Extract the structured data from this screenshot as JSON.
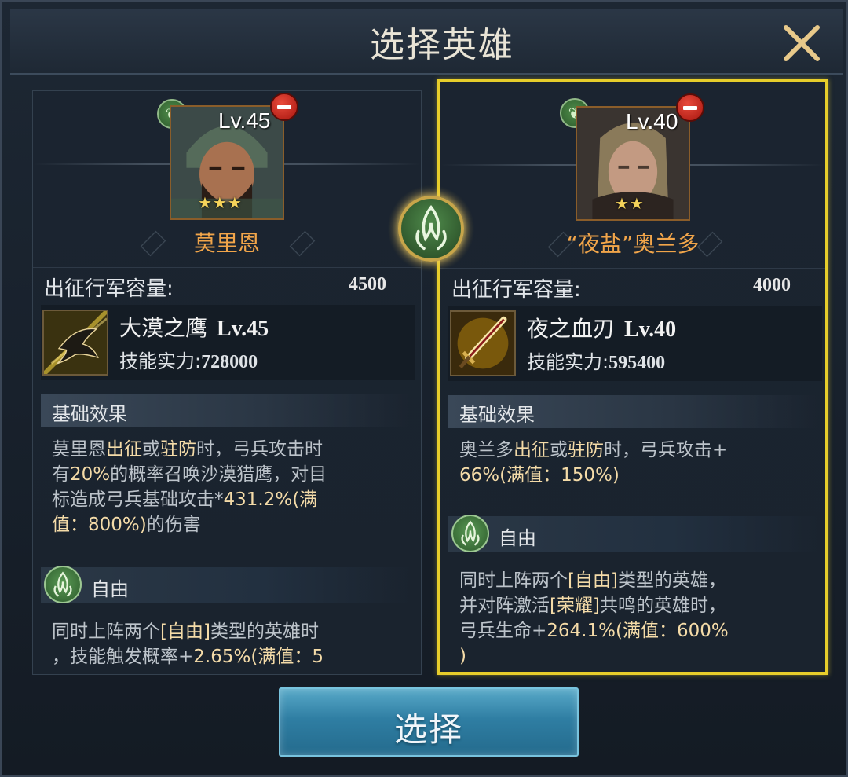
{
  "dialog": {
    "title": "选择英雄",
    "close_icon": "close-x-icon",
    "select_button": "选择"
  },
  "heroes": [
    {
      "name": "莫里恩",
      "level": "Lv.45",
      "stars": "★★★",
      "capacity_label": "出征行军容量:",
      "capacity_value": "4500",
      "skill": {
        "name": "大漠之鹰",
        "level": "Lv.45",
        "power_label": "技能实力:",
        "power_value": "728000"
      },
      "base_effect_label": "基础效果",
      "base_effect": {
        "line1_a": "莫里恩",
        "line1_b": "出征",
        "line1_c": "或",
        "line1_d": "驻防",
        "line1_e": "时，弓兵攻击时",
        "line2_a": "有",
        "line2_b": "20%",
        "line2_c": "的概率召唤沙漠猎鹰，对目",
        "line3_a": "标造成弓兵基础攻击*",
        "line3_b": "431.2%(满",
        "line4_a": "值：800%)",
        "line4_b": "的伤害"
      },
      "tag_label": "自由",
      "tag_effect": {
        "line1_a": "同时上阵两个",
        "line1_b": "[自由]",
        "line1_c": "类型的英雄时",
        "line2_a": "，技能触发概率+",
        "line2_b": "2.65%(满值：5"
      }
    },
    {
      "name": "“夜盐”奥兰多",
      "level": "Lv.40",
      "stars": "★★",
      "capacity_label": "出征行军容量:",
      "capacity_value": "4000",
      "skill": {
        "name": "夜之血刃",
        "level": "Lv.40",
        "power_label": "技能实力:",
        "power_value": "595400"
      },
      "base_effect_label": "基础效果",
      "base_effect": {
        "line1_a": "奥兰多",
        "line1_b": "出征",
        "line1_c": "或",
        "line1_d": "驻防",
        "line1_e": "时，弓兵攻击+",
        "line2_a": "66%(满值：150%)"
      },
      "tag_label": "自由",
      "tag_effect": {
        "line1_a": "同时上阵两个",
        "line1_b": "[自由]",
        "line1_c": "类型的英雄，",
        "line2_a": "并对阵激活",
        "line2_b": "[荣耀]",
        "line2_c": "共鸣的英雄时，",
        "line3_a": "弓兵生命+",
        "line3_b": "264.1%(满值：600%",
        "line4_a": ")"
      }
    }
  ],
  "colors": {
    "accent_gold": "#e6cd2b",
    "name_orange": "#f1a54a",
    "highlight": "#f4dba8",
    "button_blue": "#2f7ea3"
  }
}
